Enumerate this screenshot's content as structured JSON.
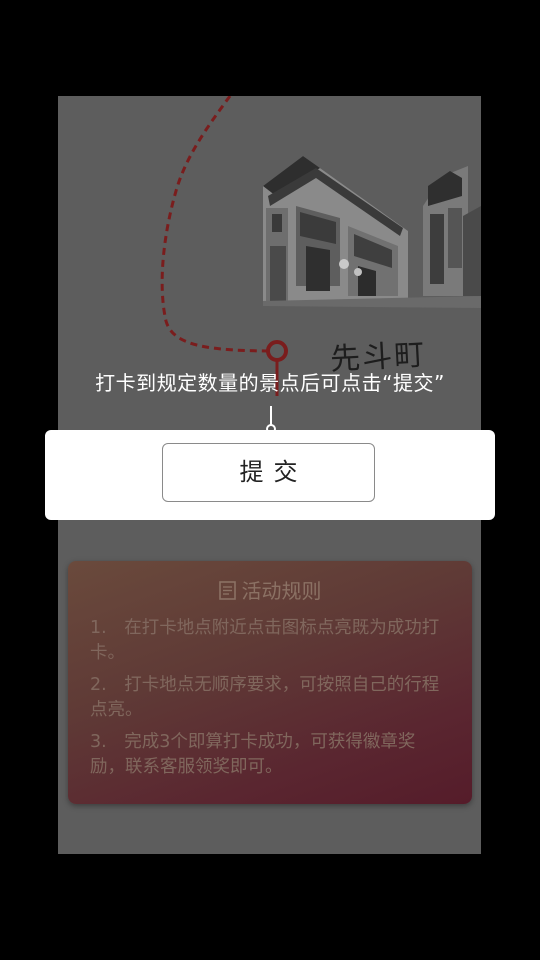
{
  "map": {
    "spot_name": "先斗町",
    "route_color": "#7a1d1d"
  },
  "tip": {
    "text": "打卡到规定数量的景点后可点击“提交”"
  },
  "submit": {
    "label": "提交"
  },
  "rules": {
    "title": "活动规则",
    "items": [
      "1.　在打卡地点附近点击图标点亮既为成功打卡。",
      "2.　打卡地点无顺序要求，可按照自己的行程点亮。",
      "3.　完成3个即算打卡成功，可获得徽章奖励，联系客服领奖即可。"
    ]
  }
}
